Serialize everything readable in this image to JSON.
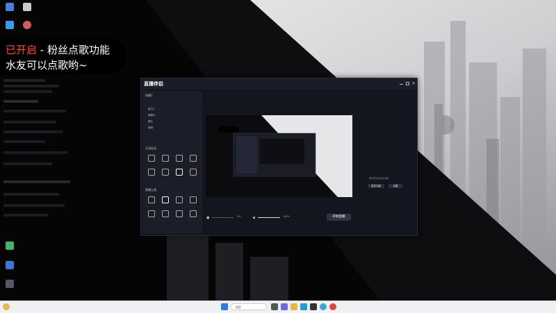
{
  "overlay": {
    "line1_highlight": "已开启",
    "line1_rest": " - 粉丝点歌功能",
    "line2": "水友可以点歌哟~"
  },
  "app": {
    "title": "直播伴侣",
    "left_panel": {
      "scene_label": "场景1",
      "section_interactive": "互动玩法",
      "section_tools": "直播工具",
      "items": [
        "窗口1",
        "摄像头",
        "图片",
        "音频"
      ]
    },
    "right_panel": {
      "empty_hint": "暂未开启互动功能",
      "btn_a": "更多功能",
      "btn_b": "设置"
    },
    "bottom": {
      "mic_pct": "0%",
      "speaker_pct": "100%",
      "go_live": "开始直播"
    }
  },
  "taskbar": {
    "search_placeholder": "搜索",
    "time": "",
    "date": ""
  },
  "colors": {
    "accent_red": "#ff4b2b",
    "app_bg": "#14161f",
    "taskbar_bg": "#eef0f3"
  }
}
